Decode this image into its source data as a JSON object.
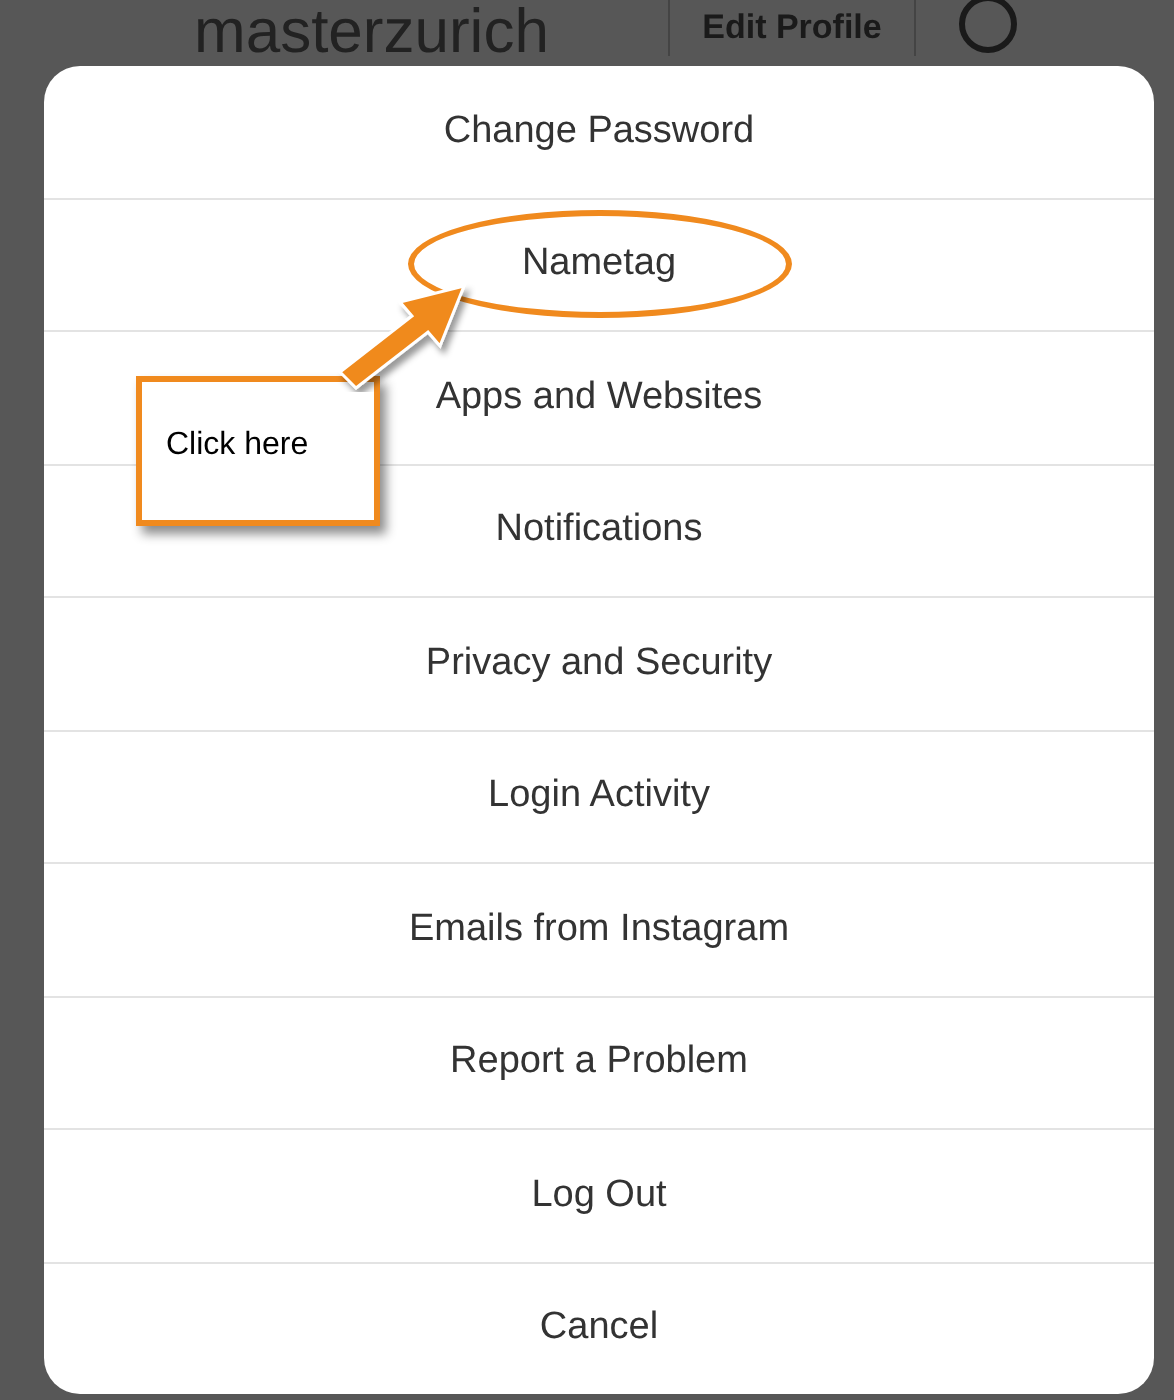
{
  "profile_header": {
    "username": "masterzurich",
    "edit_button": "Edit Profile"
  },
  "menu_items": [
    {
      "label": "Change Password",
      "circled": false
    },
    {
      "label": "Nametag",
      "circled": true
    },
    {
      "label": "Apps and Websites",
      "circled": false
    },
    {
      "label": "Notifications",
      "circled": false
    },
    {
      "label": "Privacy and Security",
      "circled": false
    },
    {
      "label": "Login Activity",
      "circled": false
    },
    {
      "label": "Emails from Instagram",
      "circled": false
    },
    {
      "label": "Report a Problem",
      "circled": false
    },
    {
      "label": "Log Out",
      "circled": false
    },
    {
      "label": "Cancel",
      "circled": false
    }
  ],
  "callout": {
    "text": "Click here"
  }
}
